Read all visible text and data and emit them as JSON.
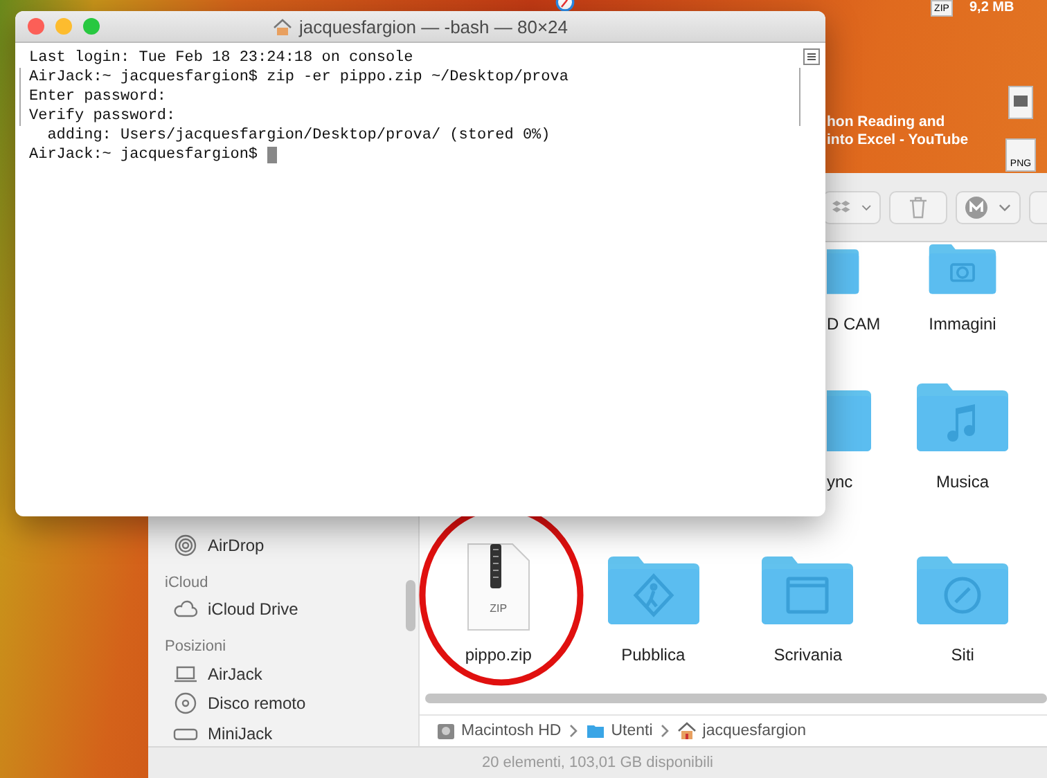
{
  "desktop": {
    "file_size": "9,2 MB",
    "video_title_lines": [
      "hon Reading and",
      "into Excel - YouTube"
    ],
    "files": [
      {
        "kind": "zip",
        "badge": "ZIP"
      },
      {
        "kind": "document"
      },
      {
        "kind": "image",
        "badge": "PNG"
      }
    ]
  },
  "finder": {
    "sidebar": [
      {
        "kind": "item",
        "label": "AirDrop"
      },
      {
        "kind": "heading",
        "label": "iCloud"
      },
      {
        "kind": "item",
        "label": "iCloud Drive"
      },
      {
        "kind": "heading",
        "label": "Posizioni"
      },
      {
        "kind": "item",
        "label": "AirJack"
      },
      {
        "kind": "item",
        "label": "Disco remoto"
      },
      {
        "kind": "item",
        "label": "MiniJack"
      }
    ],
    "rows": [
      [
        {
          "kind": "folder",
          "label": "D CAM"
        },
        {
          "kind": "folder",
          "label": "Immagini"
        }
      ],
      [
        {
          "kind": "folder",
          "label": "ync"
        },
        {
          "kind": "folder",
          "label": "Musica"
        }
      ],
      [
        {
          "kind": "zip",
          "badge": "ZIP",
          "label": "pippo.zip"
        },
        {
          "kind": "folder",
          "label": "Pubblica"
        },
        {
          "kind": "folder",
          "label": "Scrivania"
        },
        {
          "kind": "folder",
          "label": "Siti"
        }
      ]
    ],
    "path": [
      {
        "label": "Macintosh HD"
      },
      {
        "label": "Utenti"
      },
      {
        "label": "jacquesfargion"
      }
    ],
    "status": "20 elementi, 103,01 GB disponibili"
  },
  "terminal": {
    "title": "jacquesfargion — -bash — 80×24",
    "lines": [
      {
        "text": "Last login: Tue Feb 18 23:24:18 on console",
        "marked": false
      },
      {
        "text": "AirJack:~ jacquesfargion$ zip -er pippo.zip ~/Desktop/prova",
        "marked": true
      },
      {
        "text": "Enter password:",
        "marked": true
      },
      {
        "text": "Verify password:",
        "marked": true
      },
      {
        "text": "  adding: Users/jacquesfargion/Desktop/prova/ (stored 0%)",
        "marked": false
      },
      {
        "text": "AirJack:~ jacquesfargion$ ",
        "marked": false
      }
    ]
  }
}
